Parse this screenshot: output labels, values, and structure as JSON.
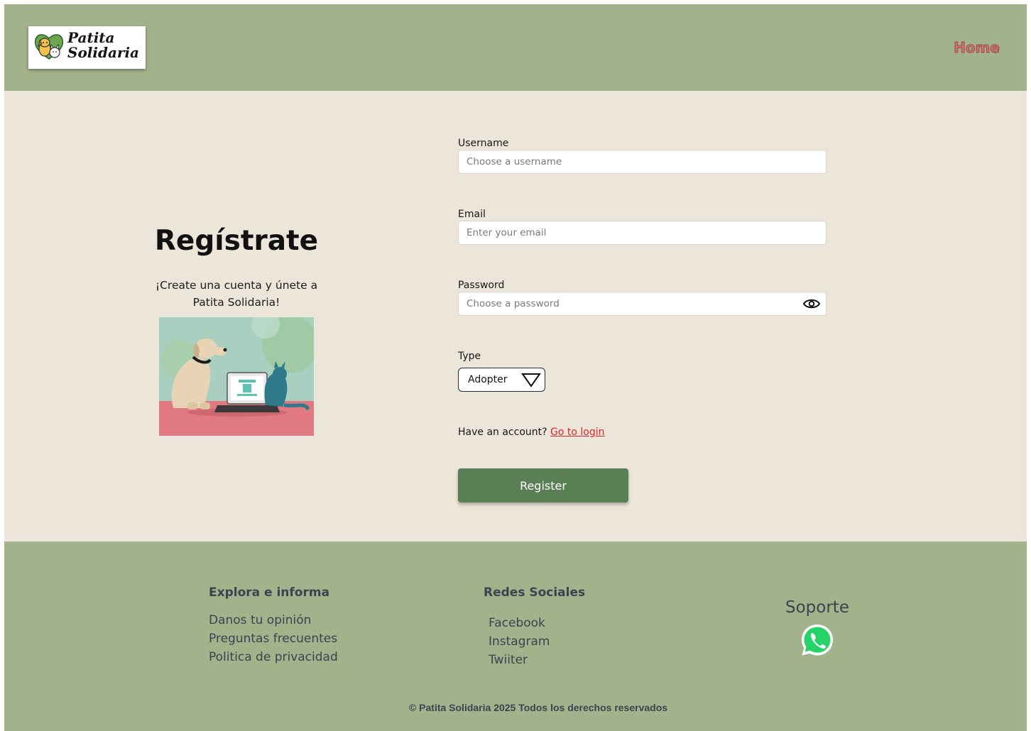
{
  "header": {
    "logo_line1": "Patita",
    "logo_line2": "Solidaria",
    "nav_home": "Home"
  },
  "intro": {
    "title": "Regístrate",
    "subtitle": "¡Create una cuenta y únete a Patita Solidaria!"
  },
  "form": {
    "username_label": "Username",
    "username_placeholder": "Choose a username",
    "email_label": "Email",
    "email_placeholder": "Enter your email",
    "password_label": "Password",
    "password_placeholder": "Choose a password",
    "type_label": "Type",
    "type_value": "Adopter",
    "have_account": "Have an account?",
    "login_link": "Go to login",
    "register_button": "Register"
  },
  "footer": {
    "explore_heading": "Explora e informa",
    "explore_links": [
      "Danos tu opinión",
      "Preguntas frecuentes",
      "Politica de privacidad"
    ],
    "social_heading": "Redes Sociales",
    "social_links": [
      "Facebook",
      "Instagram",
      "Twiiter"
    ],
    "support_heading": "Soporte",
    "copyright": "© Patita Solidaria 2025 Todos los derechos reservados"
  },
  "colors": {
    "header_bg": "#a2b28b",
    "main_bg": "#ece5da",
    "register_bg": "#5b7f55",
    "link": "#e02525",
    "whatsapp": "#25d366"
  },
  "icons": {
    "eye": "eye-icon",
    "dropdown": "triangle-down-icon",
    "support": "whatsapp-icon",
    "logo": "dog-cat-logo-icon"
  }
}
